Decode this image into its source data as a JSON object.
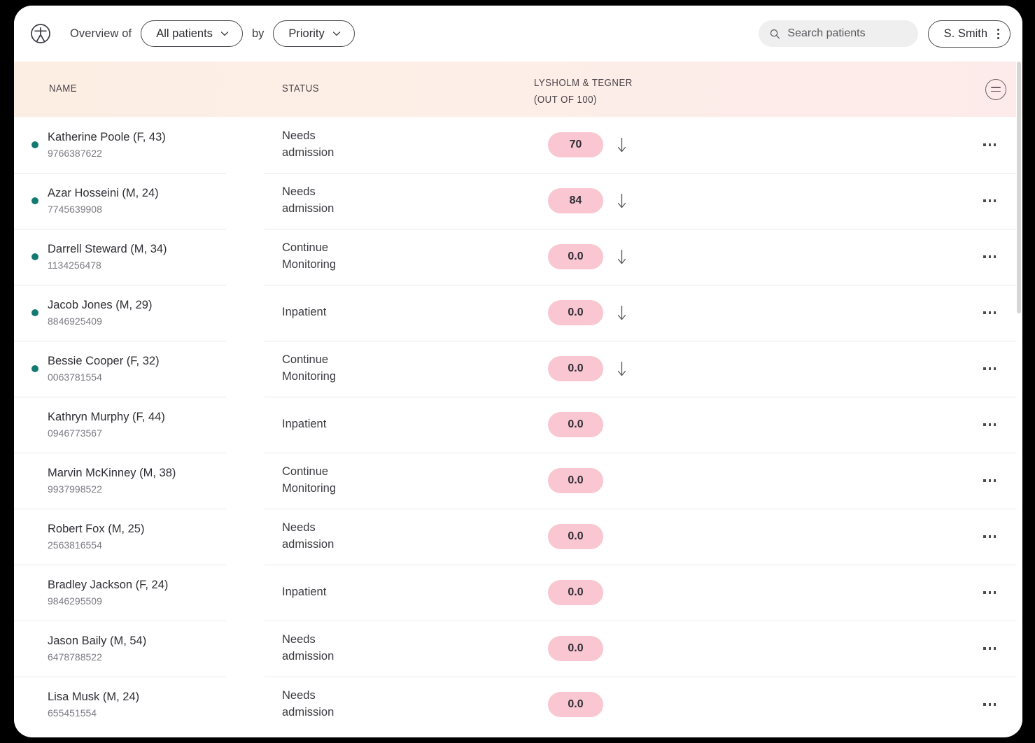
{
  "topbar": {
    "logo_icon": "person-in-circle-logo-icon",
    "overview_label": "Overview of",
    "cohort_filter": {
      "value": "All patients",
      "chevron_icon": "chevron-down-icon"
    },
    "by_label": "by",
    "sort_filter": {
      "value": "Priority",
      "chevron_icon": "chevron-down-icon"
    },
    "search": {
      "icon": "search-icon",
      "placeholder": "Search patients",
      "value": ""
    },
    "user": {
      "name": "S. Smith",
      "menu_icon": "kebab-vertical-icon"
    }
  },
  "table": {
    "headers": {
      "name": "NAME",
      "status": "STATUS",
      "score_line1": "LYSHOLM & TEGNER",
      "score_line2": "(OUT OF 100)"
    },
    "header_menu_icon": "hamburger-circle-icon",
    "row_menu_icon": "kebab-horizontal-icon",
    "trend_icon": "arrow-down-icon",
    "colors": {
      "header_gradient_start": "#fdeee4",
      "header_gradient_end": "#fdebeb",
      "score_pill_bg": "#f9c6d1",
      "priority_dot": "#137a72",
      "row_divider": "#e8e8e8",
      "card_bg": "#ffffff",
      "page_bg": "#000000"
    },
    "rows": [
      {
        "priority": true,
        "name": "Katherine Poole (F, 43)",
        "id": "9766387622",
        "status_l1": "Needs",
        "status_l2": "admission",
        "score": "70",
        "trend": "down"
      },
      {
        "priority": true,
        "name": "Azar Hosseini (M, 24)",
        "id": "7745639908",
        "status_l1": "Needs",
        "status_l2": "admission",
        "score": "84",
        "trend": "down"
      },
      {
        "priority": true,
        "name": "Darrell Steward (M, 34)",
        "id": "1134256478",
        "status_l1": "Continue",
        "status_l2": "Monitoring",
        "score": "0.0",
        "trend": "down"
      },
      {
        "priority": true,
        "name": "Jacob Jones (M, 29)",
        "id": "8846925409",
        "status_l1": "Inpatient",
        "status_l2": "",
        "score": "0.0",
        "trend": "down"
      },
      {
        "priority": true,
        "name": "Bessie Cooper (F, 32)",
        "id": "0063781554",
        "status_l1": "Continue",
        "status_l2": "Monitoring",
        "score": "0.0",
        "trend": "down"
      },
      {
        "priority": false,
        "name": "Kathryn Murphy (F, 44)",
        "id": "0946773567",
        "status_l1": "Inpatient",
        "status_l2": "",
        "score": "0.0",
        "trend": "none"
      },
      {
        "priority": false,
        "name": "Marvin McKinney (M, 38)",
        "id": "9937998522",
        "status_l1": "Continue",
        "status_l2": "Monitoring",
        "score": "0.0",
        "trend": "none"
      },
      {
        "priority": false,
        "name": "Robert Fox (M, 25)",
        "id": "2563816554",
        "status_l1": "Needs",
        "status_l2": "admission",
        "score": "0.0",
        "trend": "none"
      },
      {
        "priority": false,
        "name": "Bradley Jackson (F, 24)",
        "id": "9846295509",
        "status_l1": "Inpatient",
        "status_l2": "",
        "score": "0.0",
        "trend": "none"
      },
      {
        "priority": false,
        "name": "Jason Baily (M, 54)",
        "id": "6478788522",
        "status_l1": "Needs",
        "status_l2": "admission",
        "score": "0.0",
        "trend": "none"
      },
      {
        "priority": false,
        "name": "Lisa Musk (M, 24)",
        "id": "655451554",
        "status_l1": "Needs",
        "status_l2": "admission",
        "score": "0.0",
        "trend": "none"
      }
    ]
  }
}
